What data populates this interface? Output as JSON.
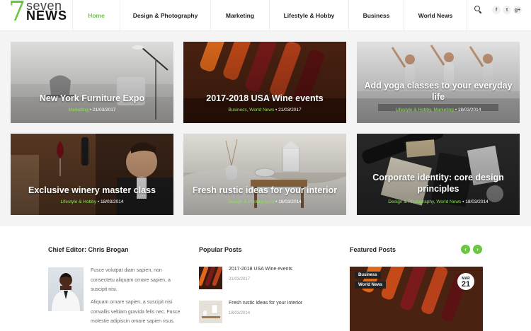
{
  "logo": {
    "number": "7",
    "line1": "seven",
    "line2": "NEWS"
  },
  "nav": {
    "items": [
      {
        "label": "Home",
        "active": true
      },
      {
        "label": "Design & Photography",
        "active": false
      },
      {
        "label": "Marketing",
        "active": false
      },
      {
        "label": "Lifestyle & Hobby",
        "active": false
      },
      {
        "label": "Business",
        "active": false
      },
      {
        "label": "World News",
        "active": false
      }
    ]
  },
  "social": {
    "facebook": "f",
    "twitter": "t",
    "googleplus": "g+"
  },
  "posts": [
    {
      "title": "New York Furniture Expo",
      "category": "Marketing",
      "date": "21/03/2017"
    },
    {
      "title": "2017-2018 USA Wine events",
      "category": "Business, World News",
      "date": "21/03/2017"
    },
    {
      "title": "Add yoga classes to your everyday life",
      "category": "Lifestyle & Hobby, Marketing",
      "date": "18/03/2014"
    },
    {
      "title": "Exclusive winery master class",
      "category": "Lifestyle & Hobby",
      "date": "18/03/2014"
    },
    {
      "title": "Fresh rustic ideas for your interior",
      "category": "Design & Photography",
      "date": "18/03/2014"
    },
    {
      "title": "Corporate identity: core design principles",
      "category": "Design & Photography, World News",
      "date": "18/03/2014"
    }
  ],
  "editor": {
    "heading": "Chief Editor: Chris Brogan",
    "para1": "Fusce volutpat diam sapien, non consectetu aliquam ornare sapien, a suscipit nisi.",
    "para2": "Aliquam ornare sapien, a suscipit nisi convallis veltiam gravida felis nec. Fusce molestie adipiscin ornare sapien risus."
  },
  "popular": {
    "heading": "Popular Posts",
    "items": [
      {
        "title": "2017-2018 USA Wine events",
        "date": "21/03/2017"
      },
      {
        "title": "Fresh rustic ideas for your interior",
        "date": "18/03/2014"
      }
    ]
  },
  "featured": {
    "heading": "Featured Posts",
    "prev": "‹",
    "next": "›",
    "badges": [
      "Business",
      "World News"
    ],
    "month": "MAR",
    "day": "21"
  },
  "colors": {
    "accent": "#6cc644"
  }
}
